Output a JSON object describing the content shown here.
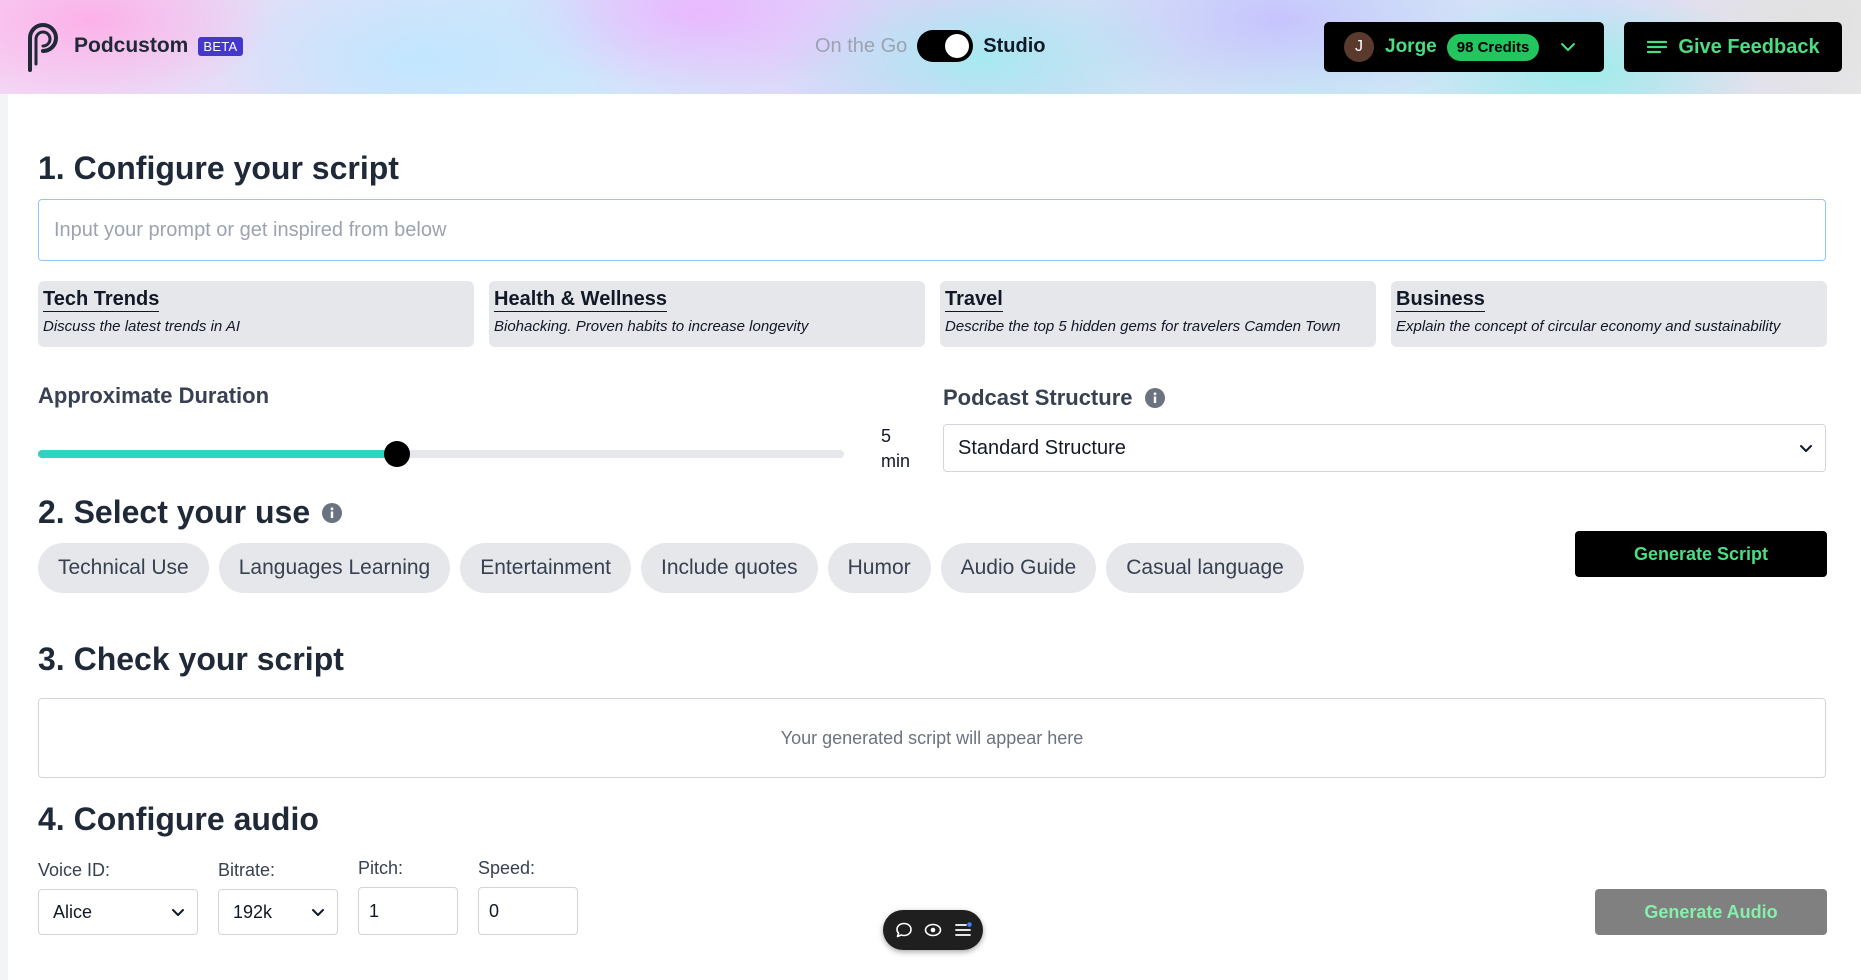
{
  "header": {
    "brand": "Podcustom",
    "beta": "BETA",
    "mode_off": "On the Go",
    "mode_on": "Studio",
    "user_initial": "J",
    "user_name": "Jorge",
    "credits": "98 Credits",
    "feedback_label": "Give Feedback"
  },
  "section1": {
    "title": "1. Configure your script",
    "prompt_placeholder": "Input your prompt or get inspired from below",
    "cards": [
      {
        "title": "Tech Trends",
        "desc": "Discuss the latest trends in AI"
      },
      {
        "title": "Health & Wellness",
        "desc": "Biohacking. Proven habits to increase longevity"
      },
      {
        "title": "Travel",
        "desc": "Describe the top 5 hidden gems for travelers Camden Town"
      },
      {
        "title": "Business",
        "desc": "Explain the concept of circular economy and sustainability"
      }
    ],
    "duration_label": "Approximate Duration",
    "duration_value": "5",
    "duration_unit": "min",
    "duration_fraction": 0.445,
    "structure_label": "Podcast Structure",
    "structure_value": "Standard Structure"
  },
  "section2": {
    "title": "2. Select your use",
    "uses": [
      "Technical Use",
      "Languages Learning",
      "Entertainment",
      "Include quotes",
      "Humor",
      "Audio Guide",
      "Casual language"
    ],
    "generate_label": "Generate Script"
  },
  "section3": {
    "title": "3. Check your script",
    "placeholder": "Your generated script will appear here"
  },
  "section4": {
    "title": "4. Configure audio",
    "voice_label": "Voice ID:",
    "voice_value": "Alice",
    "bitrate_label": "Bitrate:",
    "bitrate_value": "192k",
    "pitch_label": "Pitch:",
    "pitch_value": "1",
    "speed_label": "Speed:",
    "speed_value": "0",
    "generate_audio_label": "Generate Audio"
  },
  "colors": {
    "accent_green": "#4ade80",
    "slider_fill": "#2dd4bf",
    "beta_badge": "#4338ca"
  },
  "icons": [
    "podcustom-logo-icon",
    "chevron-down-icon",
    "menu-lines-icon",
    "info-icon",
    "chat-bubble-icon",
    "eye-icon",
    "list-icon"
  ]
}
